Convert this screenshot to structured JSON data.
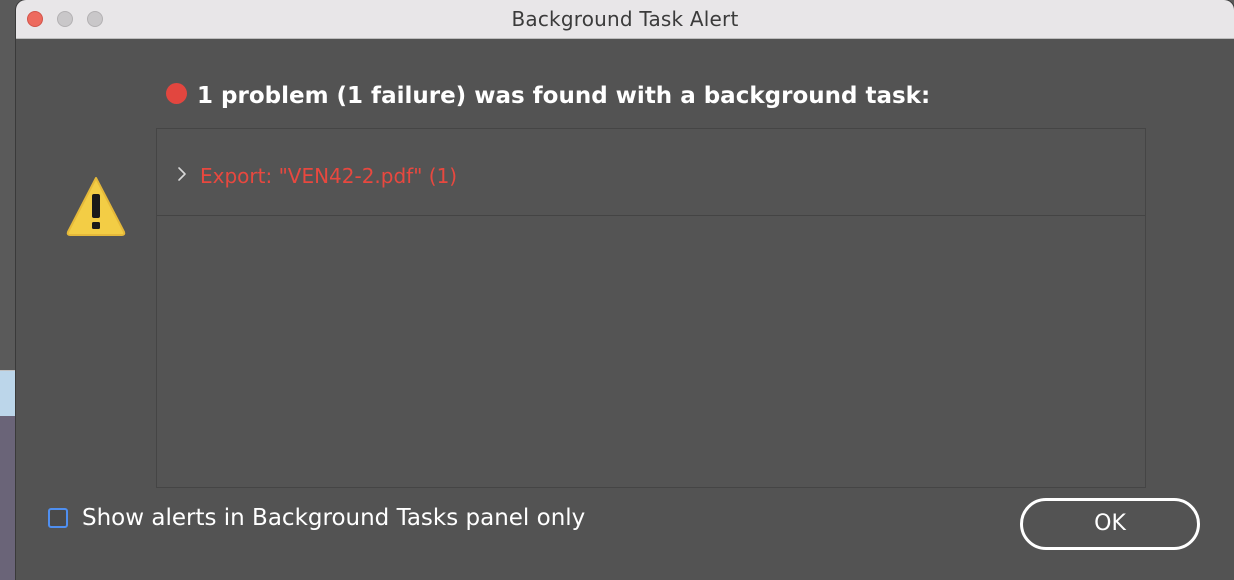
{
  "window": {
    "title": "Background Task Alert"
  },
  "alert": {
    "icon": "warning-triangle-icon",
    "heading": "1 problem (1 failure) was found with a background task:",
    "status_color": "#e2463f",
    "tasks": [
      {
        "label": "Export: \"VEN42-2.pdf\" (1)",
        "color": "#e8483f",
        "expanded": false
      }
    ]
  },
  "footer": {
    "checkbox_label": "Show alerts in Background Tasks panel only",
    "checkbox_checked": false,
    "ok_label": "OK"
  }
}
